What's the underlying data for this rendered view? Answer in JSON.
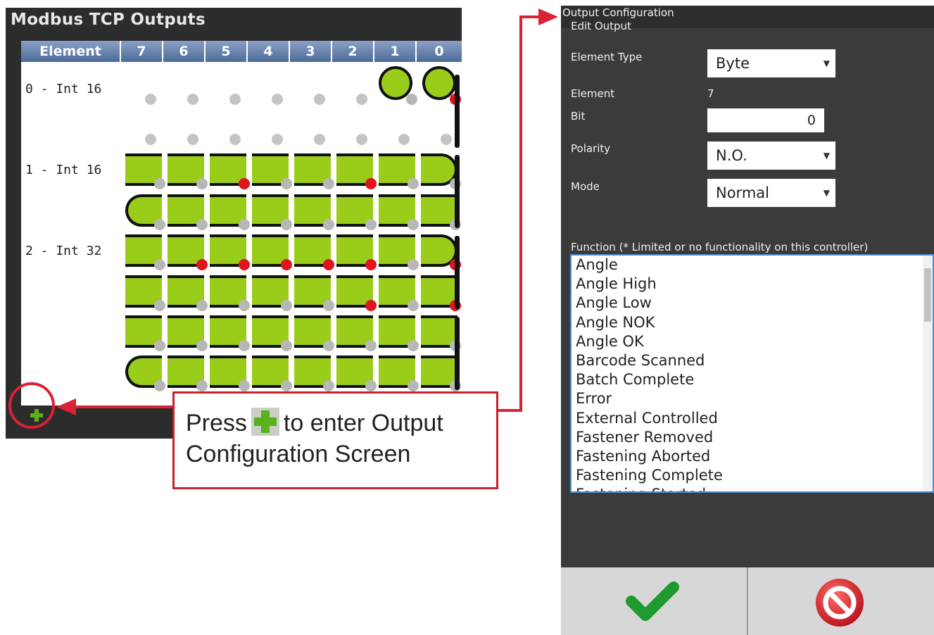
{
  "left_panel": {
    "title": "Modbus TCP Outputs",
    "header": [
      "Element",
      "7",
      "6",
      "5",
      "4",
      "3",
      "2",
      "1",
      "0"
    ],
    "rows": [
      {
        "label": "0 - Int 16"
      },
      {
        "label": "1 - Int 16"
      },
      {
        "label": "2 - Int 32"
      }
    ],
    "add_icon": "plus-icon"
  },
  "callout": {
    "text_before": "Press",
    "text_after": "to enter Output",
    "text_line2": "Configuration Screen"
  },
  "dialog": {
    "title": "Output Configuration",
    "subtitle": "Edit Output",
    "element_type_label": "Element Type",
    "element_type_value": "Byte",
    "element_label": "Element",
    "element_value": "7",
    "bit_label": "Bit",
    "bit_value": "0",
    "polarity_label": "Polarity",
    "polarity_value": "N.O.",
    "mode_label": "Mode",
    "mode_value": "Normal",
    "function_label": "Function (* Limited or no functionality on this controller)",
    "functions": [
      "Angle",
      "Angle High",
      "Angle Low",
      "Angle NOK",
      "Angle OK",
      "Barcode Scanned",
      "Batch Complete",
      "Error",
      "External Controlled",
      "Fastener Removed",
      "Fastening Aborted",
      "Fastening Complete",
      "Fastening Started"
    ],
    "ok_icon": "checkmark-icon",
    "cancel_icon": "no-entry-icon"
  },
  "colors": {
    "accent_red": "#d92234",
    "active_green": "#9acc1a",
    "header_blue": "#5d78a6",
    "dialog_bg": "#3b3b3b"
  }
}
